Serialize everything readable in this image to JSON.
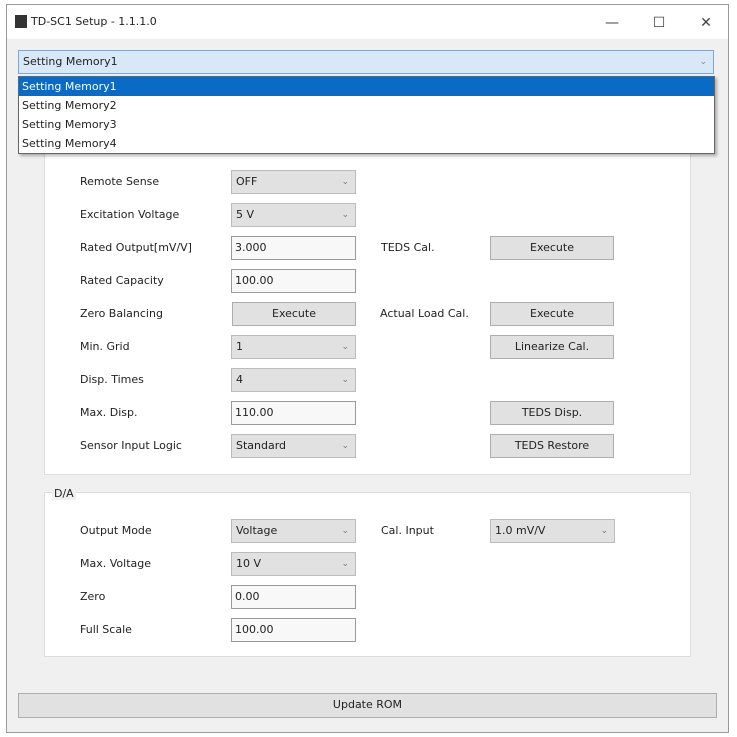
{
  "window": {
    "title": "TD-SC1 Setup - 1.1.1.0",
    "minimize": "—",
    "maximize": "☐",
    "close": "✕"
  },
  "memory": {
    "selected": "Setting Memory1",
    "options": [
      "Setting Memory1",
      "Setting Memory2",
      "Setting Memory3",
      "Setting Memory4"
    ]
  },
  "sensor": {
    "remote_sense": {
      "label": "Remote Sense",
      "value": "OFF"
    },
    "excitation": {
      "label": "Excitation Voltage",
      "value": "5 V"
    },
    "rated_output": {
      "label": "Rated Output[mV/V]",
      "value": "3.000"
    },
    "rated_capacity": {
      "label": "Rated Capacity",
      "value": "100.00"
    },
    "zero_balancing": {
      "label": "Zero Balancing",
      "button": "Execute"
    },
    "min_grid": {
      "label": "Min. Grid",
      "value": "1"
    },
    "disp_times": {
      "label": "Disp. Times",
      "value": "4"
    },
    "max_disp": {
      "label": "Max. Disp.",
      "value": "110.00"
    },
    "input_logic": {
      "label": "Sensor Input Logic",
      "value": "Standard"
    },
    "teds_cal": {
      "label": "TEDS Cal.",
      "button": "Execute"
    },
    "actual_load": {
      "label": "Actual Load Cal.",
      "button": "Execute"
    },
    "linearize": "Linearize Cal.",
    "teds_disp": "TEDS Disp.",
    "teds_restore": "TEDS Restore"
  },
  "da": {
    "title": "D/A",
    "output_mode": {
      "label": "Output Mode",
      "value": "Voltage"
    },
    "max_voltage": {
      "label": "Max. Voltage",
      "value": "10 V"
    },
    "zero": {
      "label": "Zero",
      "value": "0.00"
    },
    "full_scale": {
      "label": "Full Scale",
      "value": "100.00"
    },
    "cal_input": {
      "label": "Cal. Input",
      "value": "1.0 mV/V"
    }
  },
  "update_rom": "Update ROM",
  "chevron": "⌄"
}
